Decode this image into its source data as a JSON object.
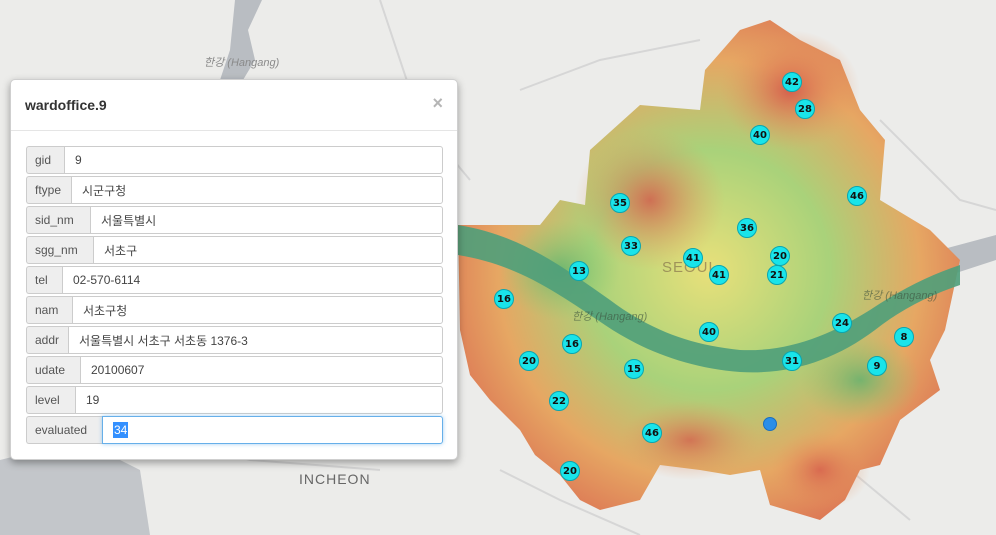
{
  "map": {
    "labels": {
      "river_top": "한강 (Hangang)",
      "river_mid": "한강 (Hangang)",
      "river_right": "한강 (Hangang)",
      "city": "INCHEON",
      "seoul": "SEOUL"
    },
    "markers": [
      "42",
      "28",
      "40",
      "46",
      "35",
      "36",
      "33",
      "41",
      "20",
      "13",
      "41",
      "21",
      "16",
      "24",
      "8",
      "40",
      "16",
      "20",
      "31",
      "15",
      "9",
      "22",
      "46",
      "20"
    ],
    "colors": {
      "marker": "#19e4ea",
      "location": "#2a8ee8",
      "river": "#4f9f7a"
    }
  },
  "popup": {
    "title": "wardoffice.9",
    "close_icon": "×",
    "fields": [
      {
        "label": "gid",
        "value": "9"
      },
      {
        "label": "ftype",
        "value": "시군구청"
      },
      {
        "label": "sid_nm",
        "value": "서울특별시"
      },
      {
        "label": "sgg_nm",
        "value": "서초구"
      },
      {
        "label": "tel",
        "value": "02-570-6114"
      },
      {
        "label": "nam",
        "value": "서초구청"
      },
      {
        "label": "addr",
        "value": "서울특별시 서초구 서초동 1376-3"
      },
      {
        "label": "udate",
        "value": "20100607"
      },
      {
        "label": "level",
        "value": "19"
      },
      {
        "label": "evaluated",
        "value": "34"
      }
    ]
  }
}
